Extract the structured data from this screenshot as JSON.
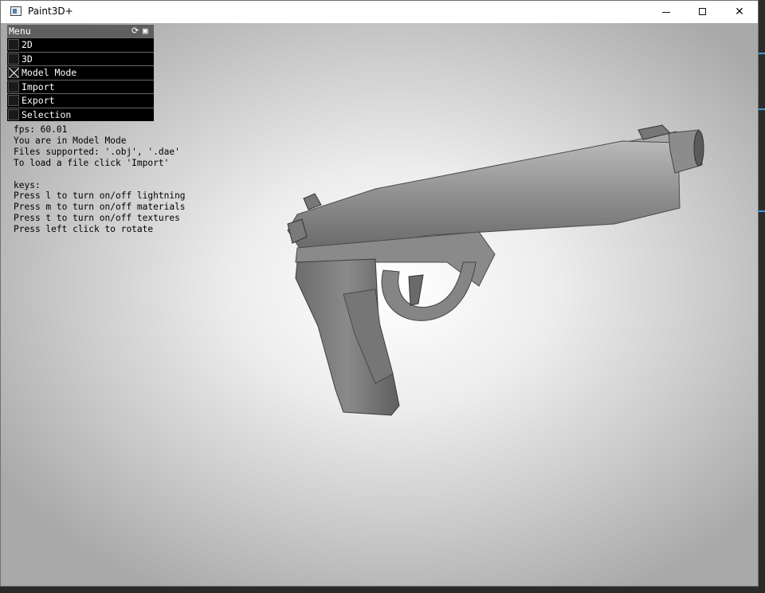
{
  "window": {
    "title": "Paint3D+"
  },
  "menu": {
    "title": "Menu",
    "items": [
      {
        "label": "2D",
        "checked": false
      },
      {
        "label": "3D",
        "checked": false
      },
      {
        "label": "Model Mode",
        "checked": true
      },
      {
        "label": "Import",
        "checked": false
      },
      {
        "label": "Export",
        "checked": false
      },
      {
        "label": "Selection",
        "checked": false
      }
    ]
  },
  "info": {
    "fps": "fps: 60.01",
    "mode": "You are in Model Mode",
    "files": "Files supported: '.obj', '.dae'",
    "load": "To load a file click 'Import'",
    "keys_title": "keys:",
    "key_l": "Press l to turn on/off lightning",
    "key_m": "Press m to turn on/off materials",
    "key_t": "Press t to turn on/off textures",
    "key_click": "Press left click to rotate"
  },
  "icons": {
    "refresh": "refresh-icon",
    "menu_save": "panel-icon"
  },
  "colors": {
    "menu_bg": "#000000",
    "menu_header": "#5f5f5f",
    "model_gray": "#8a8a8a"
  }
}
